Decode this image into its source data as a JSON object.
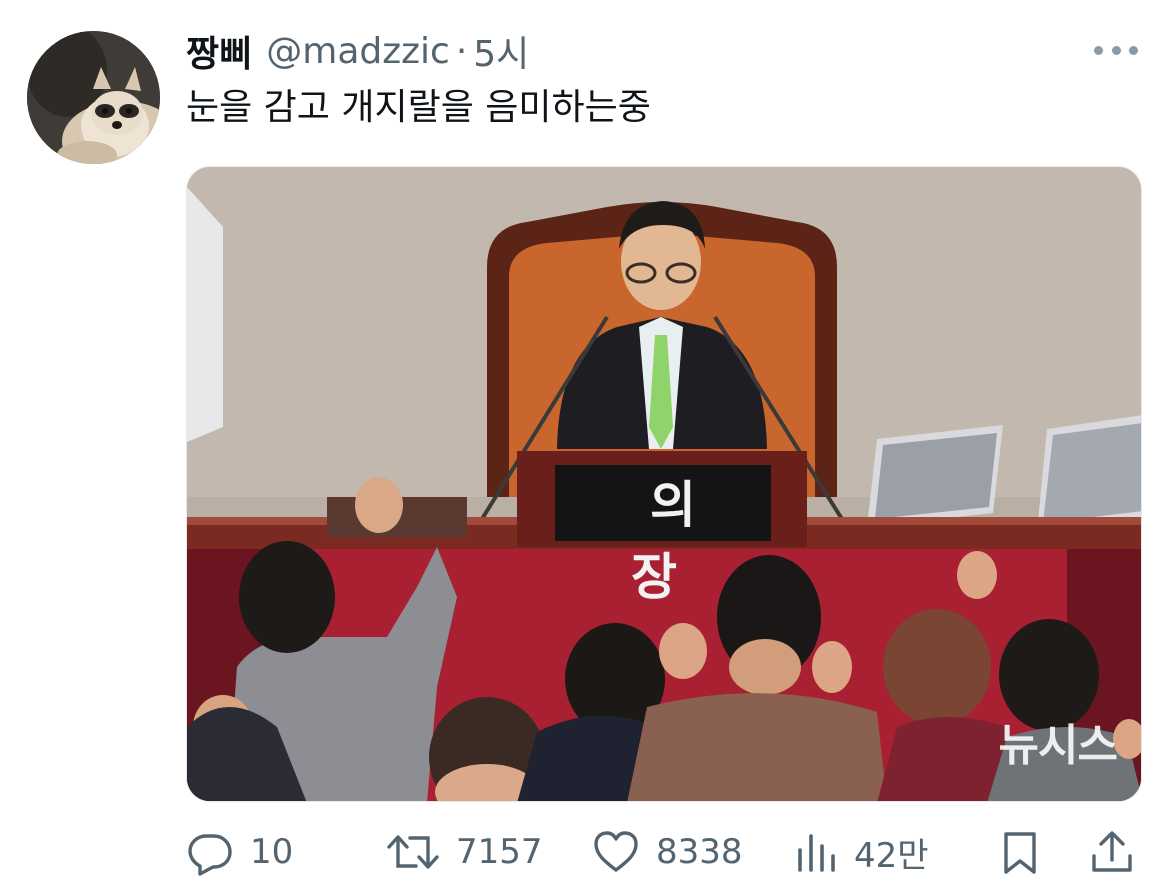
{
  "tweet": {
    "author": {
      "display_name": "짱삐",
      "handle": "@madzzic",
      "separator": "·",
      "time": "5시",
      "avatar_icon": "raccoon-avatar"
    },
    "text": "눈을 감고 개지랄을 음미하는중",
    "media": {
      "nameplate": "의 장",
      "watermark": "뉴시스"
    },
    "actions": {
      "reply": {
        "icon": "reply-icon",
        "count": "10"
      },
      "retweet": {
        "icon": "retweet-icon",
        "count": "7157"
      },
      "like": {
        "icon": "heart-icon",
        "count": "8338"
      },
      "views": {
        "icon": "views-icon",
        "count": "42만"
      },
      "bookmark": {
        "icon": "bookmark-icon"
      },
      "share": {
        "icon": "share-icon"
      }
    },
    "more_icon": "more-icon"
  },
  "colors": {
    "text_primary": "#0f1419",
    "text_secondary": "#536471"
  }
}
